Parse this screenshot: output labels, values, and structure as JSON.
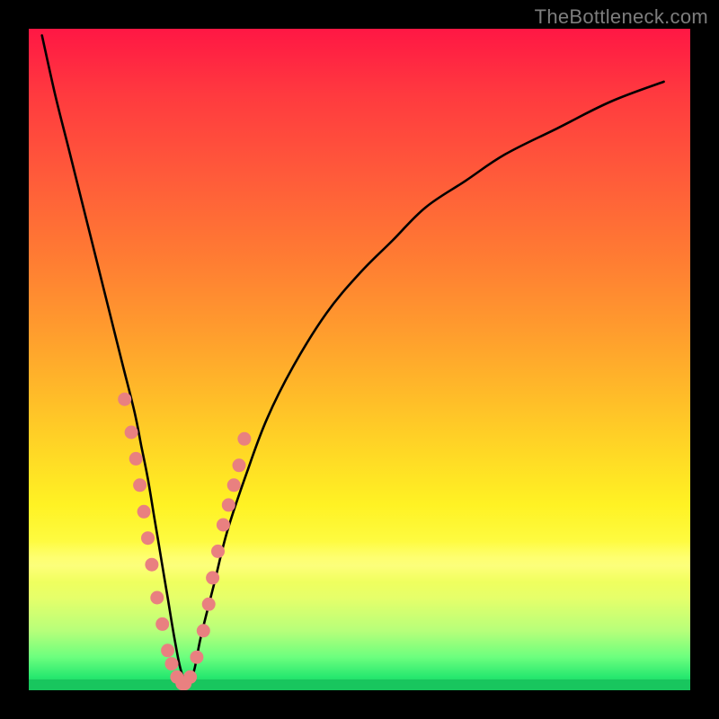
{
  "watermark": "TheBottleneck.com",
  "colors": {
    "background": "#000000",
    "curve": "#000000",
    "dots": "#e98080",
    "gradient_top": "#ff1744",
    "gradient_bottom": "#18c65e"
  },
  "chart_data": {
    "type": "line",
    "title": "",
    "xlabel": "",
    "ylabel": "",
    "xlim": [
      0,
      100
    ],
    "ylim": [
      0,
      100
    ],
    "grid": false,
    "legend": false,
    "series": [
      {
        "name": "bottleneck-curve",
        "x": [
          2,
          4,
          6,
          8,
          10,
          12,
          14,
          16,
          17,
          18,
          19,
          20,
          21,
          22,
          23,
          24,
          25,
          26,
          28,
          30,
          33,
          36,
          40,
          45,
          50,
          55,
          60,
          66,
          72,
          80,
          88,
          96
        ],
        "y": [
          99,
          90,
          82,
          74,
          66,
          58,
          50,
          42,
          37,
          32,
          26,
          20,
          14,
          8,
          3,
          1,
          3,
          8,
          16,
          24,
          33,
          41,
          49,
          57,
          63,
          68,
          73,
          77,
          81,
          85,
          89,
          92
        ]
      }
    ],
    "marked_points": {
      "name": "dotted-segment",
      "x": [
        14.5,
        15.5,
        16.2,
        16.8,
        17.4,
        18.0,
        18.6,
        19.4,
        20.2,
        21.0,
        21.6,
        22.4,
        23.2,
        23.6,
        24.4,
        25.4,
        26.4,
        27.2,
        27.8,
        28.6,
        29.4,
        30.2,
        31.0,
        31.8,
        32.6
      ],
      "y": [
        44,
        39,
        35,
        31,
        27,
        23,
        19,
        14,
        10,
        6,
        4,
        2,
        1,
        1,
        2,
        5,
        9,
        13,
        17,
        21,
        25,
        28,
        31,
        34,
        38
      ]
    }
  }
}
